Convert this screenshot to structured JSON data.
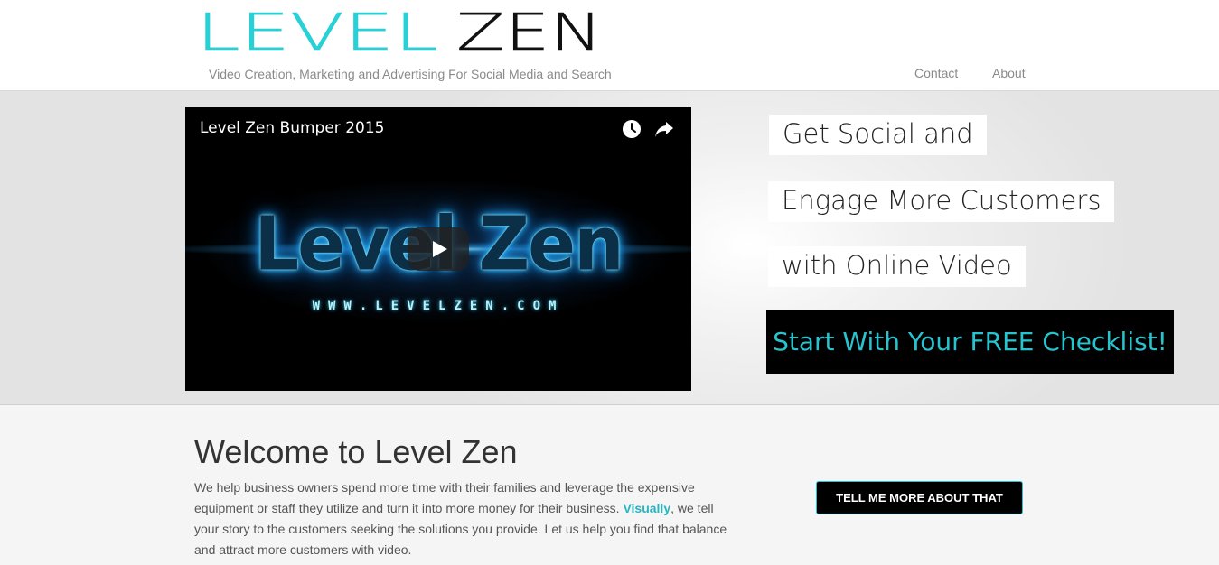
{
  "header": {
    "logo_part1": "LEVEL",
    "logo_part2": "ZEN",
    "tagline": "Video Creation, Marketing and Advertising For Social Media and Search",
    "nav": [
      {
        "label": "Contact"
      },
      {
        "label": "About"
      }
    ]
  },
  "video": {
    "title": "Level Zen Bumper 2015",
    "brand_text": "Level Zen",
    "url_text": "WWW.LEVELZEN.COM",
    "icons": [
      "watch-later-icon",
      "share-icon",
      "play-icon"
    ]
  },
  "hero": {
    "line1": "Get Social and",
    "line2": "Engage More Customers",
    "line3": "with Online Video",
    "cta": "Start With Your FREE Checklist!"
  },
  "welcome": {
    "title": "Welcome to Level Zen",
    "text_before": "We help business owners spend more time with their families and leverage the expensive equipment or staff they utilize and turn it into more money for their business. ",
    "highlight": "Visually",
    "text_after": ", we tell your story to the customers seeking the solutions you provide. Let us help you find that balance and attract more customers with video.",
    "button": "TELL ME MORE ABOUT THAT"
  },
  "colors": {
    "accent": "#27c3cf",
    "logo_dark": "#111111",
    "cta_bg": "#000000"
  }
}
